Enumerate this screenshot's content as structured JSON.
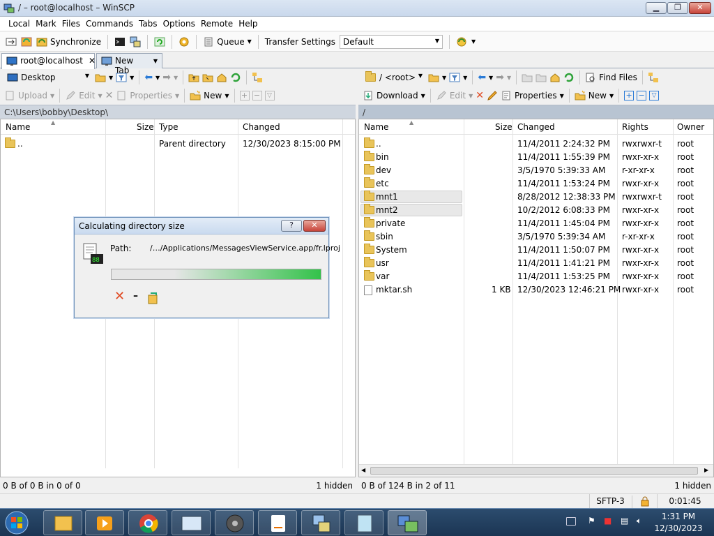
{
  "window": {
    "title": "/ – root@localhost – WinSCP",
    "min": "▁",
    "max": "❐",
    "close": "✕"
  },
  "menu": [
    "Local",
    "Mark",
    "Files",
    "Commands",
    "Tabs",
    "Options",
    "Remote",
    "Help"
  ],
  "toolbar": {
    "synchronize": "Synchronize",
    "queue": "Queue",
    "transfer_settings": "Transfer Settings",
    "transfer_value": "Default"
  },
  "tabs": [
    {
      "label": "root@localhost",
      "close": "✕"
    },
    {
      "label": "New Tab"
    }
  ],
  "local": {
    "drive": "Desktop",
    "actions": {
      "upload": "Upload",
      "edit": "Edit",
      "properties": "Properties",
      "new": "New"
    },
    "path": "C:\\Users\\bobby\\Desktop\\",
    "columns": [
      "Name",
      "Size",
      "Type",
      "Changed"
    ],
    "rows": [
      {
        "name": "..",
        "size": "",
        "type": "Parent directory",
        "changed": "12/30/2023 8:15:00 PM"
      }
    ],
    "status_left": "0 B of 0 B in 0 of 0",
    "status_right": "1 hidden"
  },
  "remote": {
    "drive": "/ <root>",
    "find_files": "Find Files",
    "actions": {
      "download": "Download",
      "edit": "Edit",
      "properties": "Properties",
      "new": "New"
    },
    "path": "/",
    "columns": [
      "Name",
      "Size",
      "Changed",
      "Rights",
      "Owner"
    ],
    "rows": [
      {
        "name": "..",
        "size": "",
        "changed": "11/4/2011 2:24:32 PM",
        "rights": "rwxrwxr-t",
        "owner": "root",
        "kind": "parent"
      },
      {
        "name": "bin",
        "size": "",
        "changed": "11/4/2011 1:55:39 PM",
        "rights": "rwxr-xr-x",
        "owner": "root",
        "kind": "folder"
      },
      {
        "name": "dev",
        "size": "",
        "changed": "3/5/1970 5:39:33 AM",
        "rights": "r-xr-xr-x",
        "owner": "root",
        "kind": "folder"
      },
      {
        "name": "etc",
        "size": "",
        "changed": "11/4/2011 1:53:24 PM",
        "rights": "rwxr-xr-x",
        "owner": "root",
        "kind": "link"
      },
      {
        "name": "mnt1",
        "size": "",
        "changed": "8/28/2012 12:38:33 PM",
        "rights": "rwxrwxr-t",
        "owner": "root",
        "kind": "folder",
        "selected": true
      },
      {
        "name": "mnt2",
        "size": "",
        "changed": "10/2/2012 6:08:33 PM",
        "rights": "rwxr-xr-x",
        "owner": "root",
        "kind": "folder",
        "selected": true
      },
      {
        "name": "private",
        "size": "",
        "changed": "11/4/2011 1:45:04 PM",
        "rights": "rwxr-xr-x",
        "owner": "root",
        "kind": "folder"
      },
      {
        "name": "sbin",
        "size": "",
        "changed": "3/5/1970 5:39:34 AM",
        "rights": "r-xr-xr-x",
        "owner": "root",
        "kind": "folder"
      },
      {
        "name": "System",
        "size": "",
        "changed": "11/4/2011 1:50:07 PM",
        "rights": "rwxr-xr-x",
        "owner": "root",
        "kind": "folder"
      },
      {
        "name": "usr",
        "size": "",
        "changed": "11/4/2011 1:41:21 PM",
        "rights": "rwxr-xr-x",
        "owner": "root",
        "kind": "folder"
      },
      {
        "name": "var",
        "size": "",
        "changed": "11/4/2011 1:53:25 PM",
        "rights": "rwxr-xr-x",
        "owner": "root",
        "kind": "link"
      },
      {
        "name": "mktar.sh",
        "size": "1 KB",
        "changed": "12/30/2023 12:46:21 PM",
        "rights": "rwxr-xr-x",
        "owner": "root",
        "kind": "file"
      }
    ],
    "status_left": "0 B of 124 B in 2 of 11",
    "status_right": "1 hidden"
  },
  "dialog": {
    "title": "Calculating directory size",
    "help": "?",
    "close": "✕",
    "path_label": "Path:",
    "path_value": "/…/Applications/MessagesViewService.app/fr.lproj",
    "progress": 0.7,
    "cancel": "✕",
    "minimize": "–"
  },
  "statusbar": {
    "protocol": "SFTP-3",
    "elapsed": "0:01:45"
  },
  "taskbar": {
    "time": "1:31 PM",
    "date": "12/30/2023"
  },
  "colors": {
    "selection": "#e8e8e8",
    "progress": "#33c24a",
    "cancel": "#e0471f"
  }
}
